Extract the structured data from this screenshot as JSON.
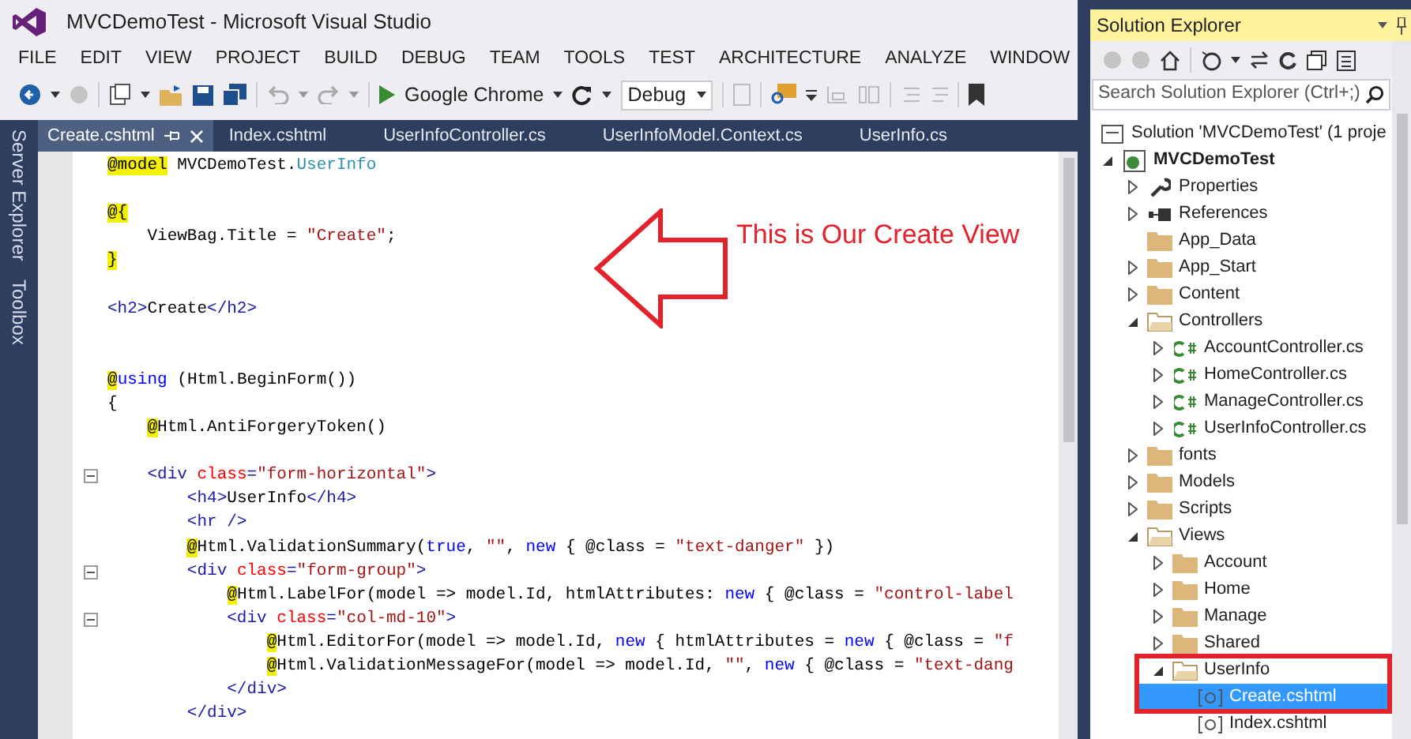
{
  "window": {
    "title": "MVCDemoTest - Microsoft Visual Studio"
  },
  "menu": [
    "FILE",
    "EDIT",
    "VIEW",
    "PROJECT",
    "BUILD",
    "DEBUG",
    "TEAM",
    "TOOLS",
    "TEST",
    "ARCHITECTURE",
    "ANALYZE",
    "WINDOW"
  ],
  "toolbar": {
    "run_target": "Google Chrome",
    "configuration": "Debug"
  },
  "side_tabs": [
    "Server Explorer",
    "Toolbox"
  ],
  "tabs": [
    {
      "label": "Create.cshtml",
      "selected": true
    },
    {
      "label": "Index.cshtml",
      "selected": false
    },
    {
      "label": "UserInfoController.cs",
      "selected": false
    },
    {
      "label": "UserInfoModel.Context.cs",
      "selected": false
    },
    {
      "label": "UserInfo.cs",
      "selected": false
    }
  ],
  "code_lines": [
    {
      "kind": "code",
      "tokens": [
        {
          "kind": "razor",
          "text": "@model"
        },
        {
          "kind": "plain",
          "text": " MVCDemoTest."
        },
        {
          "kind": "type",
          "text": "UserInfo"
        }
      ]
    },
    {
      "kind": "blank"
    },
    {
      "kind": "code",
      "tokens": [
        {
          "kind": "razor",
          "text": "@{"
        }
      ]
    },
    {
      "kind": "code",
      "tokens": [
        {
          "kind": "plain",
          "text": "    ViewBag.Title = "
        },
        {
          "kind": "string",
          "text": "\"Create\""
        },
        {
          "kind": "plain",
          "text": ";"
        }
      ]
    },
    {
      "kind": "code",
      "tokens": [
        {
          "kind": "razor",
          "text": "}"
        }
      ]
    },
    {
      "kind": "blank"
    },
    {
      "kind": "code",
      "tokens": [
        {
          "kind": "tag",
          "text": "<h2>"
        },
        {
          "kind": "plain",
          "text": "Create"
        },
        {
          "kind": "tag",
          "text": "</h2>"
        }
      ]
    },
    {
      "kind": "blank"
    },
    {
      "kind": "blank"
    },
    {
      "kind": "code",
      "tokens": [
        {
          "kind": "razor",
          "text": "@"
        },
        {
          "kind": "keyword",
          "text": "using"
        },
        {
          "kind": "plain",
          "text": " (Html.BeginForm())"
        }
      ]
    },
    {
      "kind": "code",
      "tokens": [
        {
          "kind": "plain",
          "text": "{"
        }
      ]
    },
    {
      "kind": "code",
      "tokens": [
        {
          "kind": "razor",
          "text": "    @"
        },
        {
          "kind": "plain",
          "text": "Html.AntiForgeryToken()"
        }
      ]
    },
    {
      "kind": "blank"
    },
    {
      "kind": "code",
      "fold": true,
      "tokens": [
        {
          "kind": "tag",
          "text": "    <div"
        },
        {
          "kind": "attr",
          "text": " class"
        },
        {
          "kind": "tag",
          "text": "="
        },
        {
          "kind": "string",
          "text": "\"form-horizontal\""
        },
        {
          "kind": "tag",
          "text": ">"
        }
      ]
    },
    {
      "kind": "code",
      "tokens": [
        {
          "kind": "tag",
          "text": "        <h4>"
        },
        {
          "kind": "plain",
          "text": "UserInfo"
        },
        {
          "kind": "tag",
          "text": "</h4>"
        }
      ]
    },
    {
      "kind": "code",
      "tokens": [
        {
          "kind": "tag",
          "text": "        <hr />"
        }
      ]
    },
    {
      "kind": "code",
      "tokens": [
        {
          "kind": "razor",
          "text": "        @"
        },
        {
          "kind": "plain",
          "text": "Html.ValidationSummary("
        },
        {
          "kind": "keyword",
          "text": "true"
        },
        {
          "kind": "plain",
          "text": ", "
        },
        {
          "kind": "string",
          "text": "\"\""
        },
        {
          "kind": "plain",
          "text": ", "
        },
        {
          "kind": "keyword",
          "text": "new"
        },
        {
          "kind": "plain",
          "text": " { @class = "
        },
        {
          "kind": "string",
          "text": "\"text-danger\""
        },
        {
          "kind": "plain",
          "text": " })"
        }
      ]
    },
    {
      "kind": "code",
      "fold": true,
      "tokens": [
        {
          "kind": "tag",
          "text": "        <div"
        },
        {
          "kind": "attr",
          "text": " class"
        },
        {
          "kind": "tag",
          "text": "="
        },
        {
          "kind": "string",
          "text": "\"form-group\""
        },
        {
          "kind": "tag",
          "text": ">"
        }
      ]
    },
    {
      "kind": "code",
      "tokens": [
        {
          "kind": "razor",
          "text": "            @"
        },
        {
          "kind": "plain",
          "text": "Html.LabelFor(model => model.Id, htmlAttributes: "
        },
        {
          "kind": "keyword",
          "text": "new"
        },
        {
          "kind": "plain",
          "text": " { @class = "
        },
        {
          "kind": "string",
          "text": "\"control-label"
        }
      ]
    },
    {
      "kind": "code",
      "fold": true,
      "tokens": [
        {
          "kind": "tag",
          "text": "            <div"
        },
        {
          "kind": "attr",
          "text": " class"
        },
        {
          "kind": "tag",
          "text": "="
        },
        {
          "kind": "string",
          "text": "\"col-md-10\""
        },
        {
          "kind": "tag",
          "text": ">"
        }
      ]
    },
    {
      "kind": "code",
      "tokens": [
        {
          "kind": "razor",
          "text": "                @"
        },
        {
          "kind": "plain",
          "text": "Html.EditorFor(model => model.Id, "
        },
        {
          "kind": "keyword",
          "text": "new"
        },
        {
          "kind": "plain",
          "text": " { htmlAttributes = "
        },
        {
          "kind": "keyword",
          "text": "new"
        },
        {
          "kind": "plain",
          "text": " { @class = "
        },
        {
          "kind": "string",
          "text": "\"f"
        }
      ]
    },
    {
      "kind": "code",
      "tokens": [
        {
          "kind": "razor",
          "text": "                @"
        },
        {
          "kind": "plain",
          "text": "Html.ValidationMessageFor(model => model.Id, "
        },
        {
          "kind": "string",
          "text": "\"\""
        },
        {
          "kind": "plain",
          "text": ", "
        },
        {
          "kind": "keyword",
          "text": "new"
        },
        {
          "kind": "plain",
          "text": " { @class = "
        },
        {
          "kind": "string",
          "text": "\"text-dang"
        }
      ]
    },
    {
      "kind": "code",
      "tokens": [
        {
          "kind": "tag",
          "text": "            </div>"
        }
      ]
    },
    {
      "kind": "code",
      "tokens": [
        {
          "kind": "tag",
          "text": "        </div>"
        }
      ]
    }
  ],
  "annotation": {
    "text": "This is Our Create View"
  },
  "solution_explorer": {
    "title": "Solution Explorer",
    "search": {
      "placeholder": "Search Solution Explorer (Ctrl+;)"
    },
    "tree": [
      {
        "label": "Solution 'MVCDemoTest' (1 proje",
        "kind": "solution",
        "selected": false,
        "children": [
          {
            "label": "MVCDemoTest",
            "kind": "project",
            "expanded": true,
            "selected": false,
            "children": [
              {
                "label": "Properties",
                "kind": "properties",
                "expanded": false,
                "selected": false
              },
              {
                "label": "References",
                "kind": "references",
                "expanded": false,
                "selected": false
              },
              {
                "label": "App_Data",
                "kind": "folder",
                "selected": false
              },
              {
                "label": "App_Start",
                "kind": "folder",
                "expanded": false,
                "selected": false
              },
              {
                "label": "Content",
                "kind": "folder",
                "expanded": false,
                "selected": false
              },
              {
                "label": "Controllers",
                "kind": "folder",
                "expanded": true,
                "selected": false,
                "children": [
                  {
                    "label": "AccountController.cs",
                    "kind": "csharp",
                    "expanded": false,
                    "selected": false
                  },
                  {
                    "label": "HomeController.cs",
                    "kind": "csharp",
                    "expanded": false,
                    "selected": false
                  },
                  {
                    "label": "ManageController.cs",
                    "kind": "csharp",
                    "expanded": false,
                    "selected": false
                  },
                  {
                    "label": "UserInfoController.cs",
                    "kind": "csharp",
                    "expanded": false,
                    "selected": false
                  }
                ]
              },
              {
                "label": "fonts",
                "kind": "folder",
                "expanded": false,
                "selected": false
              },
              {
                "label": "Models",
                "kind": "folder",
                "expanded": false,
                "selected": false
              },
              {
                "label": "Scripts",
                "kind": "folder",
                "expanded": false,
                "selected": false
              },
              {
                "label": "Views",
                "kind": "folder",
                "expanded": true,
                "selected": false,
                "children": [
                  {
                    "label": "Account",
                    "kind": "folder",
                    "expanded": false,
                    "selected": false
                  },
                  {
                    "label": "Home",
                    "kind": "folder",
                    "expanded": false,
                    "selected": false
                  },
                  {
                    "label": "Manage",
                    "kind": "folder",
                    "expanded": false,
                    "selected": false
                  },
                  {
                    "label": "Shared",
                    "kind": "folder",
                    "expanded": false,
                    "selected": false
                  },
                  {
                    "label": "UserInfo",
                    "kind": "folder",
                    "expanded": true,
                    "selected": false,
                    "outlined": true,
                    "children": [
                      {
                        "label": "Create.cshtml",
                        "kind": "razor",
                        "selected": true,
                        "outlined": true
                      },
                      {
                        "label": "Index.cshtml",
                        "kind": "razor",
                        "selected": false
                      }
                    ]
                  }
                ]
              }
            ]
          }
        ]
      }
    ]
  }
}
